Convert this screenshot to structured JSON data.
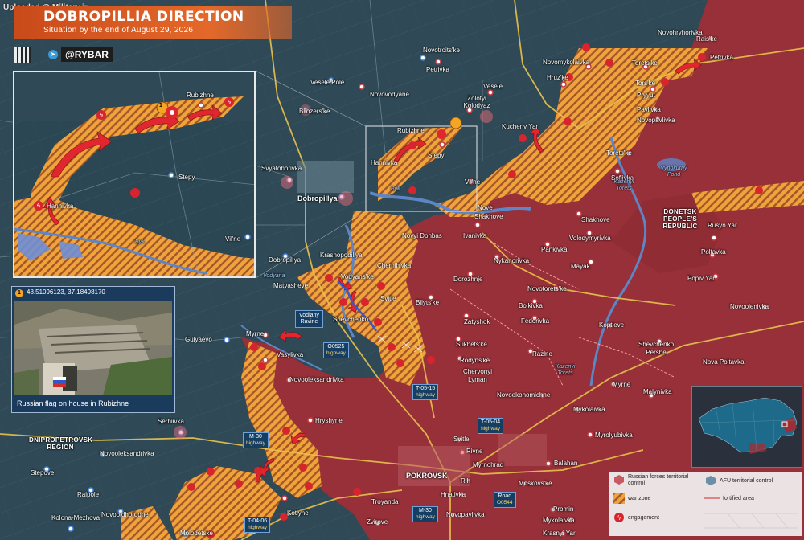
{
  "watermark": "Uploaded @ Military.ir",
  "header": {
    "title": "DOBROPILLIA DIRECTION",
    "subtitle": "Situation by the end of August 29, 2026",
    "brand": "@RYBAR"
  },
  "colors": {
    "russian_control": "#9b2f37",
    "war_zone": "#f0a33a",
    "afu_control": "#2f4a56",
    "engagement": "#d9242e",
    "highway_box": "#163e63"
  },
  "main_map": {
    "settlements": [
      "Novotroits'ke",
      "Novohryhorivka",
      "Rais'ke",
      "Petrivka",
      "Novomykolaivka",
      "Torets'ke",
      "Petrivka",
      "Vesele Pole",
      "Novovodyane",
      "Vesele",
      "Hruz'ke",
      "Tors'ke",
      "Zolotyi Kolodyaz",
      "Pryyut",
      "Bilozers'ke",
      "Pavlivka",
      "Novopavlivka",
      "Kucheriv Yar",
      "Rubizhne",
      "Svyatohorivka",
      "Stepy",
      "Torets'ke",
      "Sofiivka",
      "Dobropillya",
      "Hannivka",
      "Vil'ne",
      "Nove",
      "Shakhove",
      "Shakhove",
      "Novyi Donbas",
      "Ivanivka",
      "Rusyn Yar",
      "Dobropillya",
      "Krasnopodillya",
      "Chernihivka",
      "Volodymyrivka",
      "Poltavka",
      "Pankivka",
      "Nykanorivka",
      "Matyasheve",
      "Vodyans'ke",
      "Svitle",
      "Dorozhnje",
      "Mayak",
      "Popiv Yar",
      "Bilyts'ke",
      "Novotorets'ke",
      "Shevchenko",
      "Boikivka",
      "Novoolenivka",
      "Fedorivka",
      "Zatyshok",
      "Koptieve",
      "Myrne",
      "Gulyaevo",
      "Vasylivka",
      "Sukhets'ke",
      "Shevchenko Pershe",
      "Razine",
      "Rodyns'ke",
      "Novooleksandrivka",
      "Chervonyi Lyman",
      "Nova Poltavka",
      "Myrne",
      "Malynivka",
      "Novoekonomichne",
      "Hryshyne",
      "Mykolaivka",
      "Serhiivka",
      "Myrolyubivka",
      "Svitle",
      "Rivne",
      "Novooleksandrivka",
      "Myrnohrad",
      "Balahan",
      "Stepove",
      "POKROVSK",
      "Rih",
      "Moskovs'ke",
      "Raipole",
      "Hnativka",
      "Troyanda",
      "Novopidhorodne",
      "Promin",
      "Kotlyne",
      "Novopavlivka",
      "Mykolaivka",
      "Kolona-Mezhova",
      "Zvirove",
      "Molodetske",
      "Krasnyi Yar"
    ],
    "regions": [
      "DONETSK PEOPLE'S REPUBLIC",
      "DNIPROPETROVSK REGION"
    ],
    "water": [
      "Byk",
      "Vodyana",
      "Kazenyi Torets",
      "Vynokurny Pond",
      "Kazenyi Torets"
    ],
    "highways": [
      {
        "name": "O0525",
        "sub": "highway"
      },
      {
        "name": "T-05-15",
        "sub": "highway"
      },
      {
        "name": "T-05-04",
        "sub": "highway"
      },
      {
        "name": "M-30",
        "sub": "highway"
      },
      {
        "name": "Road",
        "sub": "O0544"
      },
      {
        "name": "M-30",
        "sub": "highway"
      },
      {
        "name": "T-04-06",
        "sub": "highway"
      }
    ],
    "ravine": [
      "Vodiany",
      "Ravine"
    ]
  },
  "inset_map": {
    "labels": [
      "Rubizhne",
      "Stepy",
      "Hannivka",
      "Vil'ne",
      "Byk"
    ],
    "marker": "1"
  },
  "photo": {
    "marker": "1",
    "coords": "48.51096123, 37.18498170",
    "caption": "Russian flag on house in Rubizhne"
  },
  "legend": {
    "russian": "Russian forces territorial control",
    "afu": "AFU territorial control",
    "war_zone": "war zone",
    "fortified": "fortified area",
    "engagement": "engagement"
  }
}
